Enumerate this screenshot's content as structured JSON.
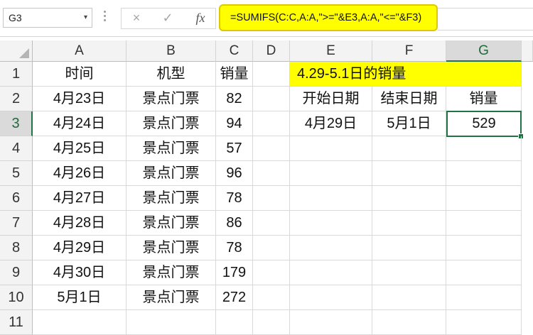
{
  "formula_bar": {
    "name_box": "G3",
    "name_box_arrow": "▾",
    "cancel_icon": "×",
    "enter_icon": "✓",
    "fx_label": "fx",
    "formula": "=SUMIFS(C:C,A:A,\">=\"&E3,A:A,\"<=\"&F3)"
  },
  "columns": [
    "A",
    "B",
    "C",
    "D",
    "E",
    "F",
    "G"
  ],
  "rows": [
    "1",
    "2",
    "3",
    "4",
    "5",
    "6",
    "7",
    "8",
    "9",
    "10",
    "11"
  ],
  "table": {
    "headers": [
      "时间",
      "机型",
      "销量"
    ],
    "rows": [
      [
        "4月23日",
        "景点门票",
        "82"
      ],
      [
        "4月24日",
        "景点门票",
        "94"
      ],
      [
        "4月25日",
        "景点门票",
        "57"
      ],
      [
        "4月26日",
        "景点门票",
        "96"
      ],
      [
        "4月27日",
        "景点门票",
        "78"
      ],
      [
        "4月28日",
        "景点门票",
        "86"
      ],
      [
        "4月29日",
        "景点门票",
        "78"
      ],
      [
        "4月30日",
        "景点门票",
        "179"
      ],
      [
        "5月1日",
        "景点门票",
        "272"
      ]
    ]
  },
  "summary": {
    "title": "4.29-5.1日的销量",
    "headers": [
      "开始日期",
      "结束日期",
      "销量"
    ],
    "values": [
      "4月29日",
      "5月1日",
      "529"
    ]
  },
  "colors": {
    "highlight": "#ffff00",
    "selection": "#217346"
  },
  "active_cell": "G3"
}
